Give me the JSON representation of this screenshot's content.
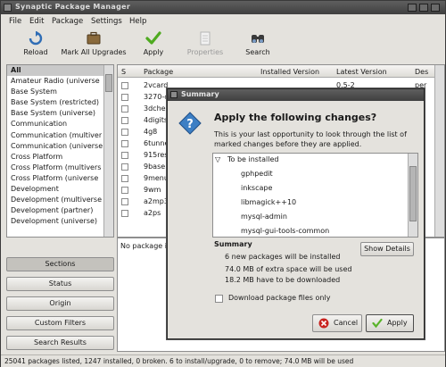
{
  "window": {
    "title": "Synaptic Package Manager"
  },
  "menu": [
    "File",
    "Edit",
    "Package",
    "Settings",
    "Help"
  ],
  "toolbar": {
    "reload": "Reload",
    "mark_all": "Mark All Upgrades",
    "apply": "Apply",
    "properties": "Properties",
    "search": "Search"
  },
  "categories": [
    "All",
    "Amateur Radio (universe",
    "Base System",
    "Base System (restricted)",
    "Base System (universe)",
    "Communication",
    "Communication (multiver",
    "Communication (universe",
    "Cross Platform",
    "Cross Platform (multivers",
    "Cross Platform (universe",
    "Development",
    "Development (multiverse",
    "Development (partner)",
    "Development (universe)"
  ],
  "filters": [
    "Sections",
    "Status",
    "Origin",
    "Custom Filters",
    "Search Results"
  ],
  "package_list": {
    "columns": {
      "s": "S",
      "package": "Package",
      "installed": "Installed Version",
      "latest": "Latest Version",
      "desc": "Des"
    },
    "rows": [
      {
        "name": "2vcard",
        "latest": "0.5-2",
        "desc": "per"
      },
      {
        "name": "3270-c",
        "latest": "",
        "desc": ""
      },
      {
        "name": "3dchess",
        "latest": "",
        "desc": ""
      },
      {
        "name": "4digits",
        "latest": "",
        "desc": ""
      },
      {
        "name": "4g8",
        "latest": "",
        "desc": ""
      },
      {
        "name": "6tunnel",
        "latest": "",
        "desc": ""
      },
      {
        "name": "915resolu",
        "latest": "",
        "desc": ""
      },
      {
        "name": "9base",
        "latest": "",
        "desc": ""
      },
      {
        "name": "9menu",
        "latest": "",
        "desc": ""
      },
      {
        "name": "9wm",
        "latest": "",
        "desc": ""
      },
      {
        "name": "a2mp3",
        "latest": "",
        "desc": ""
      },
      {
        "name": "a2ps",
        "latest": "",
        "desc": ""
      }
    ]
  },
  "info_pane": {
    "text": "No package i"
  },
  "status_bar": "25041 packages listed, 1247 installed, 0 broken. 6 to install/upgrade, 0 to remove; 74.0 MB will be used",
  "dialog": {
    "title": "Summary",
    "heading": "Apply the following changes?",
    "body": "This is your last opportunity to look through the list of marked changes before they are applied.",
    "group": "To be installed",
    "changes": [
      "gphpedit",
      "inkscape",
      "libmagick++10",
      "mysql-admin",
      "mysql-gui-tools-common",
      "postfix"
    ],
    "summary_heading": "Summary",
    "summary_lines": [
      "6 new packages will be installed",
      "74.0 MB of extra space will be used",
      "18.2 MB have to be downloaded"
    ],
    "show_details": "Show Details",
    "download_only": "Download package files only",
    "cancel": "Cancel",
    "apply": "Apply"
  },
  "colors": {
    "titlebar": "#4a4a4a",
    "dialog_icon": "#3d7fc4",
    "apply_icon": "#59b32a",
    "cancel_icon": "#c8231f"
  }
}
